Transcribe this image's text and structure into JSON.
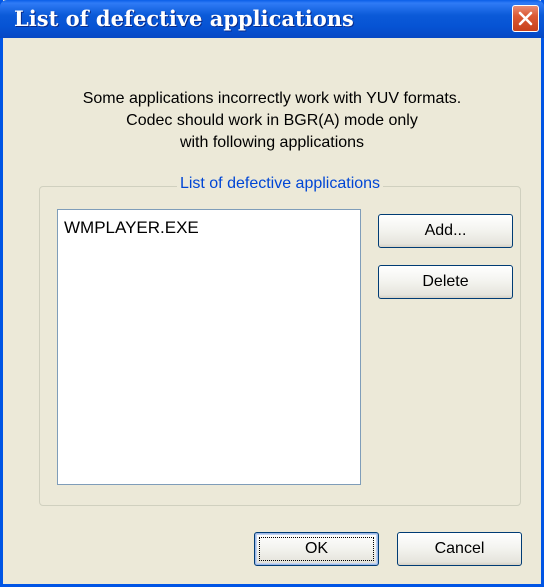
{
  "window": {
    "title": "List of defective applications"
  },
  "message": {
    "line1": "Some applications incorrectly work with YUV formats.",
    "line2": "Codec should work in BGR(A) mode only",
    "line3": "with following applications"
  },
  "group": {
    "label": "List of defective applications",
    "items": [
      "WMPLAYER.EXE"
    ]
  },
  "buttons": {
    "add": "Add...",
    "delete": "Delete",
    "ok": "OK",
    "cancel": "Cancel"
  },
  "icons": {
    "close": "close-icon"
  },
  "colors": {
    "titlebar": "#0653d4",
    "dialog_bg": "#ece9d8",
    "group_label": "#0046d5",
    "close_button": "#db5a35"
  }
}
